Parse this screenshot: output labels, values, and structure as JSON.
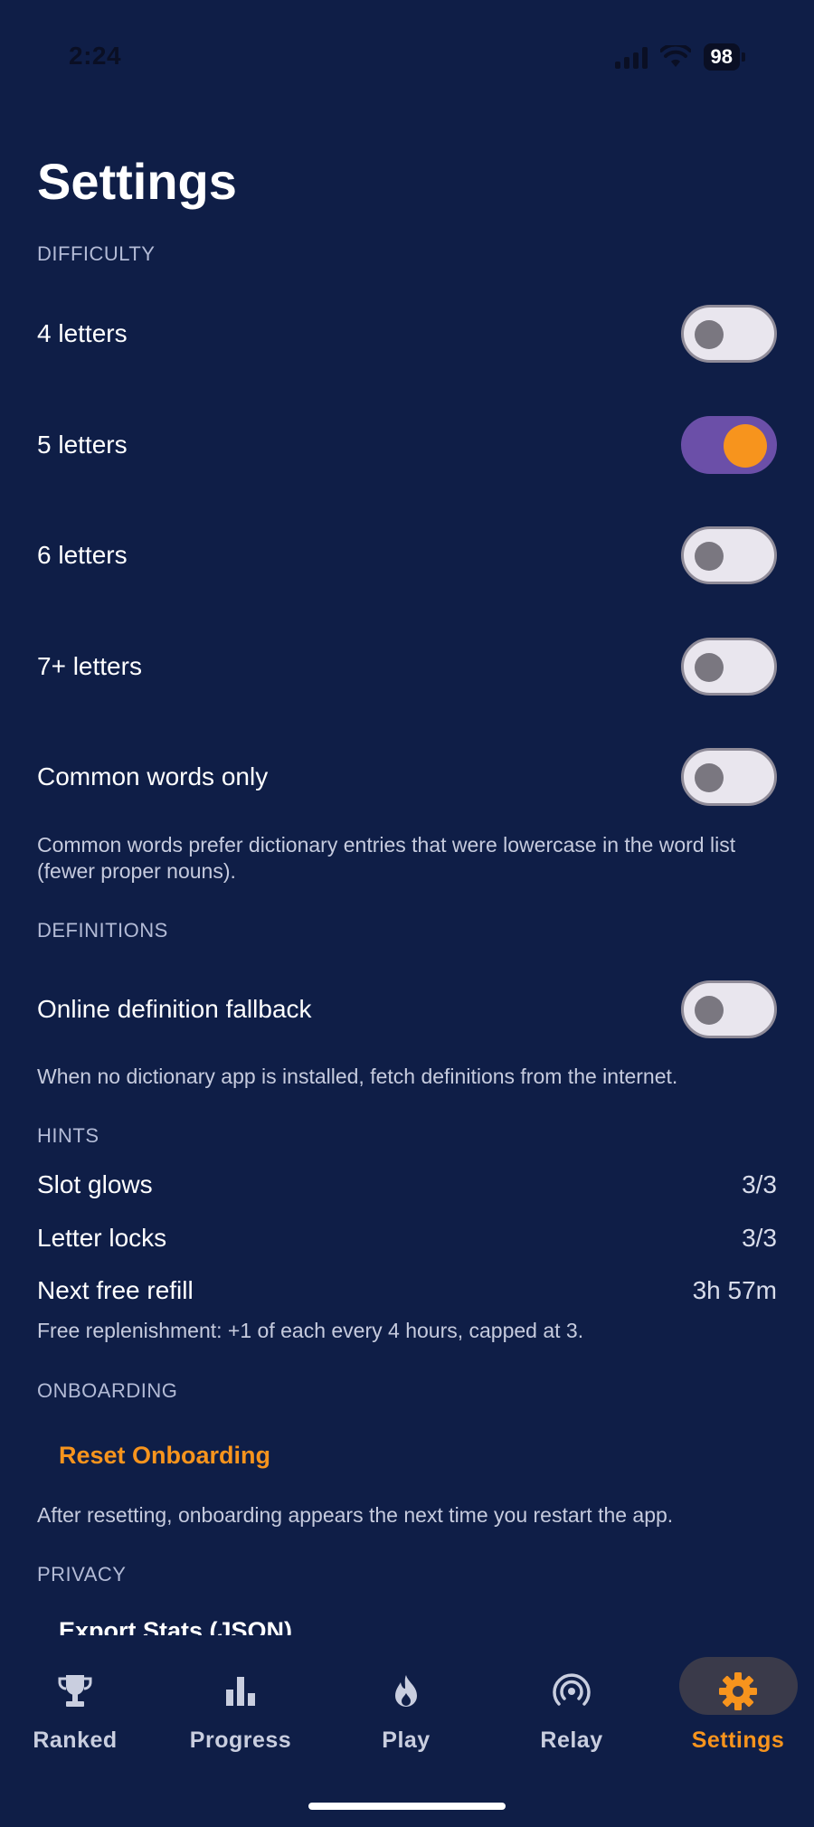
{
  "status": {
    "time": "2:24",
    "battery": "98"
  },
  "page": {
    "title": "Settings"
  },
  "difficulty": {
    "section_label": "DIFFICULTY",
    "items": [
      {
        "label": "4 letters",
        "on": false
      },
      {
        "label": "5 letters",
        "on": true
      },
      {
        "label": "6 letters",
        "on": false
      },
      {
        "label": "7+ letters",
        "on": false
      },
      {
        "label": "Common words only",
        "on": false
      }
    ],
    "note": "Common words prefer dictionary entries that were lowercase in the word list (fewer proper nouns)."
  },
  "definitions": {
    "section_label": "DEFINITIONS",
    "online_fallback": {
      "label": "Online definition fallback",
      "on": false
    },
    "note": "When no dictionary app is installed, fetch definitions from the internet."
  },
  "hints": {
    "section_label": "HINTS",
    "slot_glows": {
      "label": "Slot glows",
      "value": "3/3"
    },
    "letter_locks": {
      "label": "Letter locks",
      "value": "3/3"
    },
    "next_refill": {
      "label": "Next free refill",
      "value": "3h 57m"
    },
    "note": "Free replenishment: +1 of each every 4 hours, capped at 3."
  },
  "onboarding": {
    "section_label": "ONBOARDING",
    "reset_label": "Reset Onboarding",
    "note": "After resetting, onboarding appears the next time you restart the app."
  },
  "privacy": {
    "section_label": "PRIVACY",
    "export_label": "Export Stats (JSON)"
  },
  "tabs": [
    {
      "label": "Ranked",
      "icon": "trophy-icon"
    },
    {
      "label": "Progress",
      "icon": "bar-chart-icon"
    },
    {
      "label": "Play",
      "icon": "flame-icon"
    },
    {
      "label": "Relay",
      "icon": "broadcast-icon"
    },
    {
      "label": "Settings",
      "icon": "gear-icon",
      "active": true
    }
  ],
  "colors": {
    "background": "#0f1e47",
    "accent": "#f7941d",
    "toggle_on": "#6b4fa8"
  }
}
